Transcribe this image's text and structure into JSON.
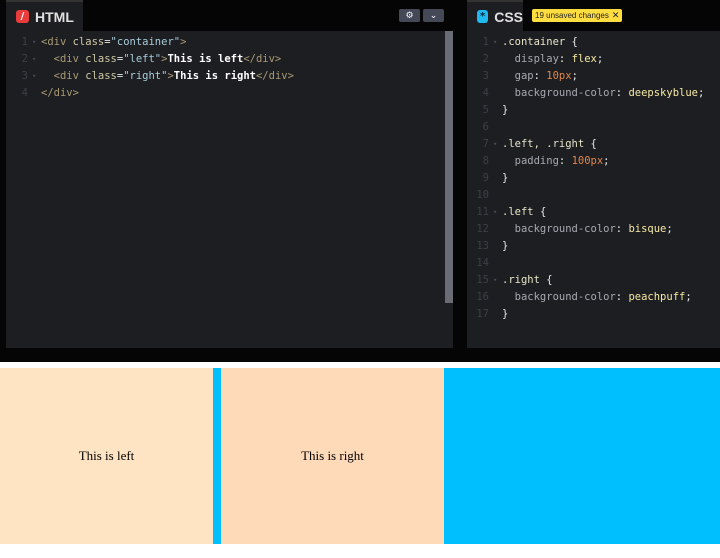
{
  "html_editor": {
    "tab_label": "HTML",
    "icon": "slash-icon",
    "settings_button": "⚙",
    "collapse_button": "⌄",
    "lines": [
      {
        "n": "1",
        "parts": [
          [
            "tagc",
            "<div "
          ],
          [
            "attr",
            "class"
          ],
          [
            "punc",
            "="
          ],
          [
            "str",
            "\"container\""
          ],
          [
            "tagc",
            ">"
          ]
        ]
      },
      {
        "n": "2",
        "parts": [
          [
            "tagc",
            "  <div "
          ],
          [
            "attr",
            "class"
          ],
          [
            "punc",
            "="
          ],
          [
            "str",
            "\"left\""
          ],
          [
            "tagc",
            ">"
          ],
          [
            "txt",
            "This is left"
          ],
          [
            "tagc",
            "</div>"
          ]
        ]
      },
      {
        "n": "3",
        "parts": [
          [
            "tagc",
            "  <div "
          ],
          [
            "attr",
            "class"
          ],
          [
            "punc",
            "="
          ],
          [
            "str",
            "\"right\""
          ],
          [
            "tagc",
            ">"
          ],
          [
            "txt",
            "This is right"
          ],
          [
            "tagc",
            "</div>"
          ]
        ]
      },
      {
        "n": "4",
        "parts": [
          [
            "tagc",
            "</div>"
          ]
        ]
      }
    ]
  },
  "css_editor": {
    "tab_label": "CSS",
    "icon": "asterisk-icon",
    "unsaved_badge": "19 unsaved changes",
    "lines": [
      {
        "n": "1",
        "parts": [
          [
            "sel",
            ".container "
          ],
          [
            "punc",
            "{"
          ]
        ]
      },
      {
        "n": "2",
        "parts": [
          [
            "prop",
            "  display"
          ],
          [
            "punc",
            ": "
          ],
          [
            "val",
            "flex"
          ],
          [
            "punc",
            ";"
          ]
        ]
      },
      {
        "n": "3",
        "parts": [
          [
            "prop",
            "  gap"
          ],
          [
            "punc",
            ": "
          ],
          [
            "num",
            "10px"
          ],
          [
            "punc",
            ";"
          ]
        ]
      },
      {
        "n": "4",
        "parts": [
          [
            "prop",
            "  background-color"
          ],
          [
            "punc",
            ": "
          ],
          [
            "val",
            "deepskyblue"
          ],
          [
            "punc",
            ";"
          ]
        ]
      },
      {
        "n": "5",
        "parts": [
          [
            "punc",
            "}"
          ]
        ]
      },
      {
        "n": "6",
        "parts": []
      },
      {
        "n": "7",
        "parts": [
          [
            "sel",
            ".left, .right "
          ],
          [
            "punc",
            "{"
          ]
        ]
      },
      {
        "n": "8",
        "parts": [
          [
            "prop",
            "  padding"
          ],
          [
            "punc",
            ": "
          ],
          [
            "num",
            "100px"
          ],
          [
            "punc",
            ";"
          ]
        ]
      },
      {
        "n": "9",
        "parts": [
          [
            "punc",
            "}"
          ]
        ]
      },
      {
        "n": "10",
        "parts": []
      },
      {
        "n": "11",
        "parts": [
          [
            "sel",
            ".left "
          ],
          [
            "punc",
            "{"
          ]
        ]
      },
      {
        "n": "12",
        "parts": [
          [
            "prop",
            "  background-color"
          ],
          [
            "punc",
            ": "
          ],
          [
            "val",
            "bisque"
          ],
          [
            "punc",
            ";"
          ]
        ]
      },
      {
        "n": "13",
        "parts": [
          [
            "punc",
            "}"
          ]
        ]
      },
      {
        "n": "14",
        "parts": []
      },
      {
        "n": "15",
        "parts": [
          [
            "sel",
            ".right "
          ],
          [
            "punc",
            "{"
          ]
        ]
      },
      {
        "n": "16",
        "parts": [
          [
            "prop",
            "  background-color"
          ],
          [
            "punc",
            ": "
          ],
          [
            "val",
            "peachpuff"
          ],
          [
            "punc",
            ";"
          ]
        ]
      },
      {
        "n": "17",
        "parts": [
          [
            "punc",
            "}"
          ]
        ]
      }
    ]
  },
  "preview": {
    "left_text": "This is left",
    "right_text": "This is right",
    "colors": {
      "container": "#00bfff",
      "left": "#ffe4c4",
      "right": "#ffdab9"
    }
  },
  "colors": {
    "html_icon": "#e93c3c",
    "css_icon": "#1fb8f0",
    "badge": "#ffdd40"
  }
}
